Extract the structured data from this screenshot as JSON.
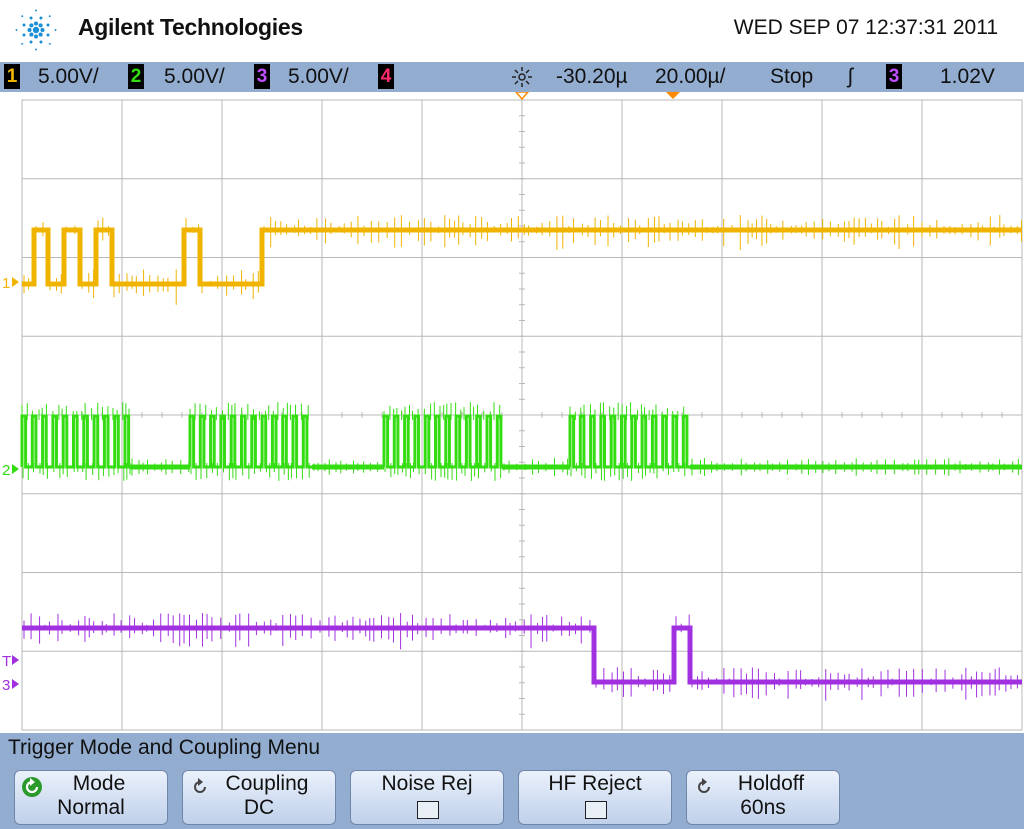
{
  "header": {
    "brand": "Agilent Technologies",
    "datetime": "WED SEP 07 12:37:31 2011"
  },
  "status_bar": {
    "channels": [
      {
        "num": "1",
        "scale": "5.00V/",
        "color": "#f0b400"
      },
      {
        "num": "2",
        "scale": "5.00V/",
        "color": "#33dd11"
      },
      {
        "num": "3",
        "scale": "5.00V/",
        "color": "#a030e0"
      },
      {
        "num": "4",
        "scale": "",
        "color": "#ff2a6a"
      }
    ],
    "delay": "-30.20µ",
    "timebase": "20.00µ/",
    "run_state": "Stop",
    "trigger_edge": "ʃ",
    "trigger_source": "3",
    "trigger_level": "1.02V"
  },
  "markers": {
    "ch1": "1",
    "ch2": "2",
    "ch3": "3",
    "trigger": "T"
  },
  "colors": {
    "ch1": "#f0b400",
    "ch2": "#33dd11",
    "ch3": "#a030e0",
    "grid": "#b8b8b8",
    "menu_bg": "#93add0",
    "trigger_marker": "#ff8a00"
  },
  "menu": {
    "title": "Trigger Mode and Coupling Menu",
    "softkeys": [
      {
        "label": "Mode",
        "value": "Normal",
        "kind": "cycle-active"
      },
      {
        "label": "Coupling",
        "value": "DC",
        "kind": "cycle"
      },
      {
        "label": "Noise Rej",
        "value": "",
        "kind": "checkbox",
        "checked": false
      },
      {
        "label": "HF Reject",
        "value": "",
        "kind": "checkbox",
        "checked": false
      },
      {
        "label": "Holdoff",
        "value": "60ns",
        "kind": "cycle"
      }
    ]
  },
  "traces": {
    "ch1": [
      [
        0,
        "L"
      ],
      [
        12,
        "H"
      ],
      [
        26,
        "L"
      ],
      [
        42,
        "H"
      ],
      [
        58,
        "L"
      ],
      [
        74,
        "H"
      ],
      [
        90,
        "L"
      ],
      [
        162,
        "H"
      ],
      [
        178,
        "L"
      ],
      [
        240,
        "H"
      ],
      [
        1000,
        "H"
      ]
    ],
    "ch2": [
      [
        0,
        "burst"
      ],
      [
        108,
        "L"
      ],
      [
        168,
        "burst"
      ],
      [
        290,
        "L"
      ],
      [
        362,
        "burst"
      ],
      [
        480,
        "L"
      ],
      [
        548,
        "burst"
      ],
      [
        668,
        "L"
      ],
      [
        1000,
        "L"
      ]
    ],
    "ch3": [
      [
        0,
        "H"
      ],
      [
        572,
        "L"
      ],
      [
        652,
        "H"
      ],
      [
        668,
        "L"
      ],
      [
        1000,
        "L"
      ]
    ]
  }
}
